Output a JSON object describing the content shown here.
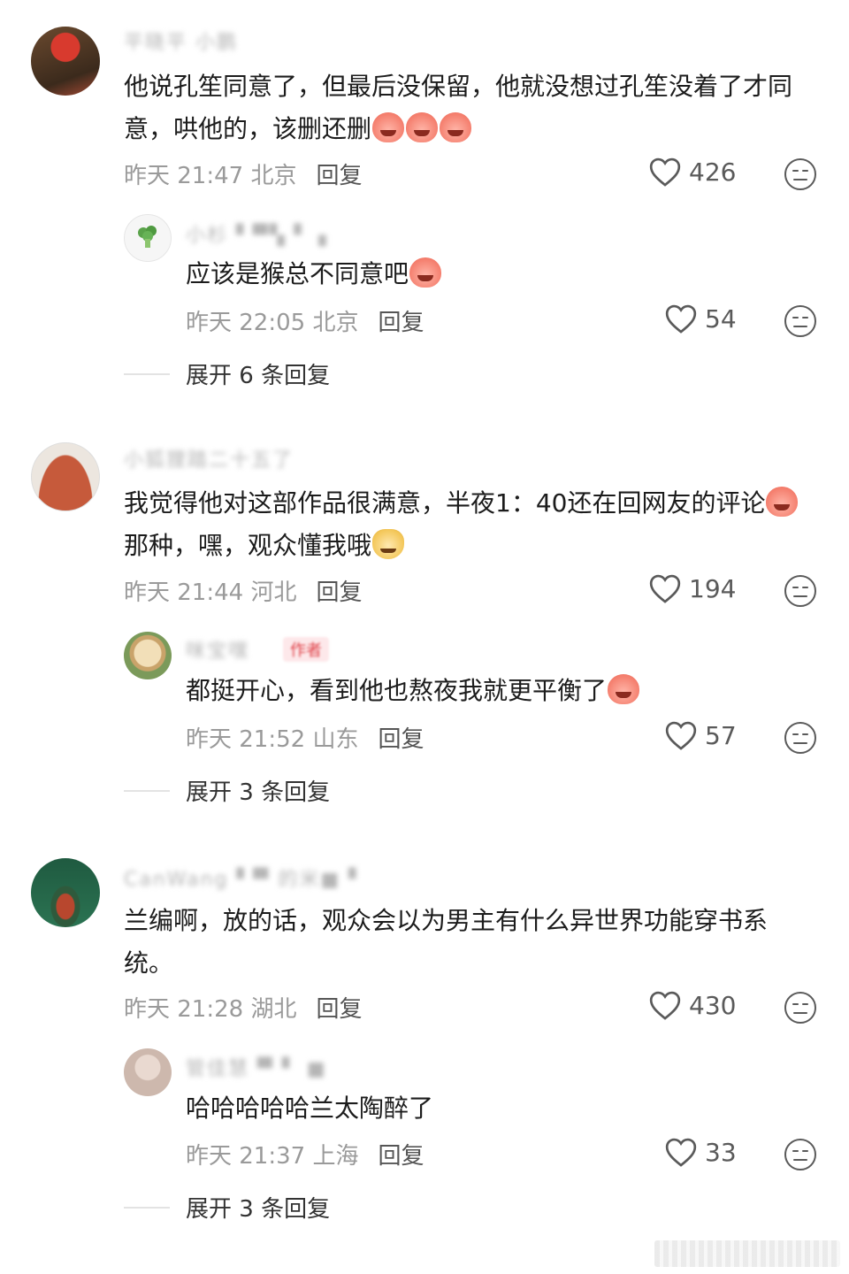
{
  "comments": [
    {
      "username": "平晓平 小鹏",
      "text": "他说孔笙同意了，但最后没保留，他就没想过孔笙没着了才同意，哄他的，该删还删",
      "emojis": [
        "crying-peach-emoji",
        "crying-peach-emoji",
        "crying-peach-emoji"
      ],
      "time": "昨天 21:47 北京",
      "reply_label": "回复",
      "likes": "426",
      "reply": {
        "username": "小杉 ▘▀▚▝ ▗",
        "text": "应该是猴总不同意吧",
        "emojis": [
          "crying-peach-emoji"
        ],
        "time": "昨天 22:05 北京",
        "reply_label": "回复",
        "likes": "54"
      },
      "expand_label": "展开 6 条回复"
    },
    {
      "username": "小狐狸踏二十五了",
      "text": "我觉得他对这部作品很满意，半夜1：40还在回网友的评论",
      "text_after_emoji": "那种，嘿，观众懂我哦",
      "emojis": [
        "crying-peach-emoji",
        "doge-emoji"
      ],
      "time": "昨天 21:44 河北",
      "reply_label": "回复",
      "likes": "194",
      "reply": {
        "username": "咪宝嘿",
        "badge": "作者",
        "text": "都挺开心，看到他也熬夜我就更平衡了",
        "emojis": [
          "shy-peach-emoji"
        ],
        "time": "昨天 21:52 山东",
        "reply_label": "回复",
        "likes": "57"
      },
      "expand_label": "展开 3 条回复"
    },
    {
      "username": "CanWang ▘▀ 的米■ ▘",
      "text": "兰编啊，放的话，观众会以为男主有什么异世界功能穿书系统。",
      "time": "昨天 21:28 湖北",
      "reply_label": "回复",
      "likes": "430",
      "reply": {
        "username": "管佳慧 ▀ ▘ ■",
        "text": "哈哈哈哈哈兰太陶醉了",
        "time": "昨天 21:37 上海",
        "reply_label": "回复",
        "likes": "33"
      },
      "expand_label": "展开 3 条回复"
    }
  ],
  "icons": {
    "like": "heart-outline-icon",
    "dislike": "meh-face-icon"
  },
  "colors": {
    "meta": "#9a9a9a",
    "text": "#1c1c1c",
    "author_badge": "#e0434a"
  }
}
